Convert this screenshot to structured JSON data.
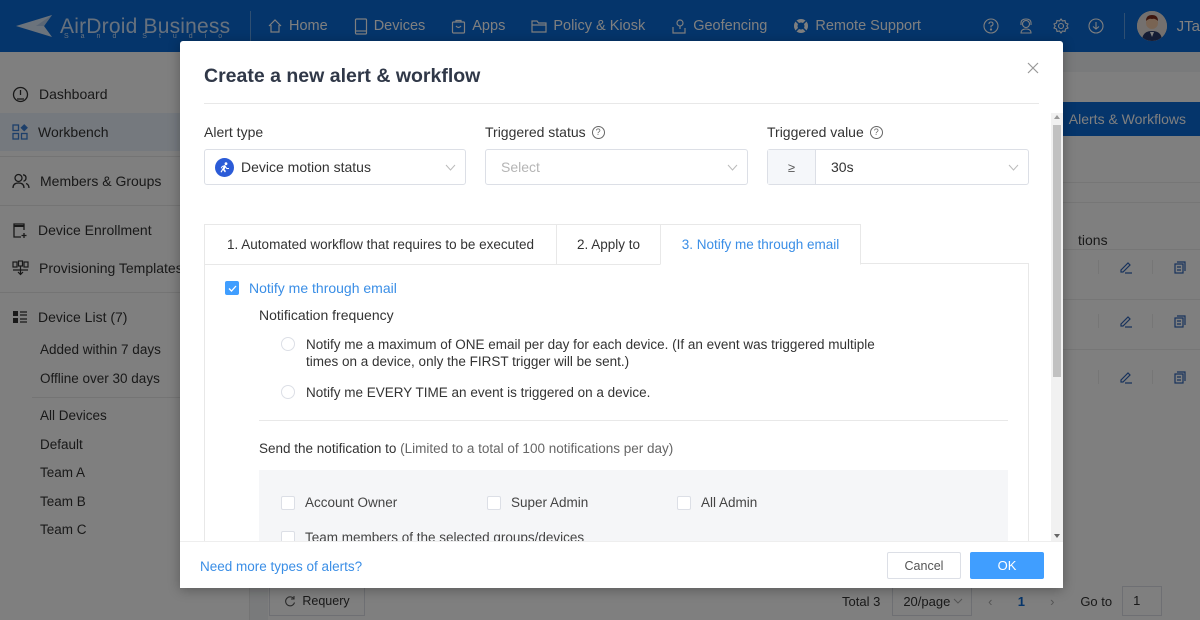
{
  "app": {
    "brand": "AirDroid Business",
    "brand_sub": "Sand Studio",
    "user_name": "JTa"
  },
  "topnav": [
    {
      "label": "Home",
      "icon": "home-icon"
    },
    {
      "label": "Devices",
      "icon": "device-icon"
    },
    {
      "label": "Apps",
      "icon": "apps-icon"
    },
    {
      "label": "Policy & Kiosk",
      "icon": "folder-icon"
    },
    {
      "label": "Geofencing",
      "icon": "geofence-icon"
    },
    {
      "label": "Remote Support",
      "icon": "lifebuoy-icon"
    }
  ],
  "top_icons": [
    "help-icon",
    "support-agent-icon",
    "gear-icon",
    "download-icon"
  ],
  "sidebar": {
    "items": [
      {
        "label": "Dashboard",
        "icon": "dashboard-icon"
      },
      {
        "label": "Workbench",
        "icon": "workbench-icon",
        "active": true
      },
      {
        "label": "Members & Groups",
        "icon": "members-icon"
      },
      {
        "label": "Device Enrollment",
        "icon": "enrollment-icon"
      },
      {
        "label": "Provisioning Templates",
        "icon": "templates-icon"
      },
      {
        "label": "Device List (7)",
        "icon": "list-icon"
      }
    ],
    "filters": [
      "Added within 7 days",
      "Offline over 30 days"
    ],
    "groups": [
      "All Devices",
      "Default",
      "Team A",
      "Team B",
      "Team C"
    ]
  },
  "background": {
    "alerts_button": "Alerts & Workflows",
    "col_header_fragment": "tions",
    "requery": "Requery",
    "total": "Total 3",
    "page_size": "20/page",
    "current_page": "1",
    "goto_label": "Go to",
    "goto_value": "1"
  },
  "modal": {
    "title": "Create a new alert & workflow",
    "alert_type": {
      "label": "Alert type",
      "value": "Device motion status"
    },
    "triggered_status": {
      "label": "Triggered status",
      "placeholder": "Select"
    },
    "triggered_value": {
      "label": "Triggered value",
      "operator": "≥",
      "value": "30s"
    },
    "tabs": [
      {
        "label": "1. Automated workflow that requires to be executed",
        "active": false
      },
      {
        "label": "2. Apply to",
        "active": false
      },
      {
        "label": "3. Notify me through email",
        "active": true
      }
    ],
    "notify": {
      "checkbox_label": "Notify me through email",
      "checked": true,
      "frequency_title": "Notification frequency",
      "freq_options": [
        {
          "line1": "Notify me a maximum of ONE email per day for each device. (If an event was triggered multiple",
          "line2": "times on a device, only the FIRST trigger will be sent.)",
          "selected": false
        },
        {
          "line1": "Notify me EVERY TIME an event is triggered on a device.",
          "line2": "",
          "selected": false
        }
      ],
      "send_title": "Send the notification to",
      "send_note": "(Limited to a total of 100 notifications per day)",
      "recipients": [
        {
          "label": "Account Owner",
          "checked": false
        },
        {
          "label": "Super Admin",
          "checked": false
        },
        {
          "label": "All Admin",
          "checked": false
        },
        {
          "label": "Team members of the selected groups/devices",
          "checked": false
        }
      ]
    },
    "footer": {
      "more_link": "Need more types of alerts?",
      "cancel": "Cancel",
      "ok": "OK"
    }
  },
  "colors": {
    "topbar": "#0a6ad6",
    "primary": "#409eff",
    "link": "#3a8ee6",
    "motion_icon": "#2b5bd7"
  }
}
